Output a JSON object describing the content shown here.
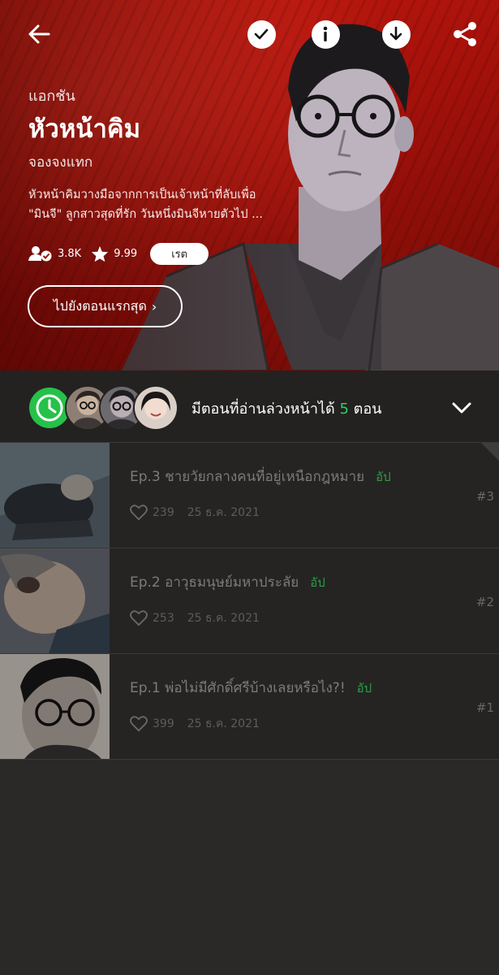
{
  "topbar": {
    "back_icon": "arrow-left-icon",
    "subscribe_icon": "check-icon",
    "info_icon": "info-icon",
    "download_icon": "download-icon",
    "share_icon": "share-icon"
  },
  "hero": {
    "genre": "แอกชัน",
    "title": "หัวหน้าคิม",
    "author": "จองจงแทก",
    "synopsis_line1": "หัวหน้าคิมวางมือจากการเป็นเจ้าหน้าที่ลับเพื่อ",
    "synopsis_line2": "\"มินจี\" ลูกสาวสุดที่รัก วันหนึ่งมินจีหายตัวไป ...",
    "subscribers": "3.8K",
    "rating": "9.99",
    "rate_label": "เรต",
    "first_episode_label": "ไปยังตอนแรกสุด",
    "colors": {
      "background": "#b3140c",
      "accent": "#ffffff"
    }
  },
  "preview": {
    "text_before": "มีตอนที่อ่านล่วงหน้าได้",
    "count": "5",
    "text_after": "ตอน",
    "accent": "#2bd25b"
  },
  "episodes": [
    {
      "title": "Ep.3 ชายวัยกลางคนที่อยู่เหนือกฎหมาย",
      "badge": "อัป",
      "likes": "239",
      "date": "25 ธ.ค. 2021",
      "number": "#3"
    },
    {
      "title": "Ep.2 อาวุธมนุษย์มหาประลัย",
      "badge": "อัป",
      "likes": "253",
      "date": "25 ธ.ค. 2021",
      "number": "#2"
    },
    {
      "title": "Ep.1 พ่อไม่มีศักดิ์ศรีบ้างเลยหรือไง?!",
      "badge": "อัป",
      "likes": "399",
      "date": "25 ธ.ค. 2021",
      "number": "#1"
    }
  ]
}
